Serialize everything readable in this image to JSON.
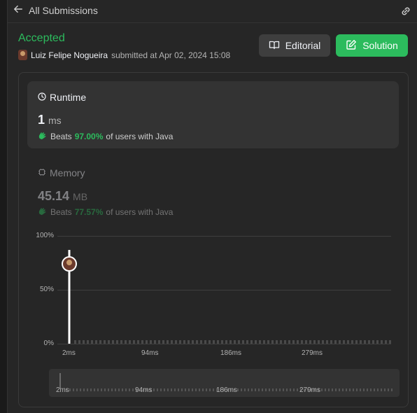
{
  "topbar": {
    "back_label": "All Submissions"
  },
  "submission": {
    "status": "Accepted",
    "author": "Luiz Felipe Nogueira",
    "submitted_text": "submitted at Apr 02, 2024 15:08"
  },
  "buttons": {
    "editorial": "Editorial",
    "solution": "Solution"
  },
  "runtime": {
    "title": "Runtime",
    "value": "1",
    "unit": "ms",
    "beats_prefix": "Beats",
    "beats_pct": "97.00%",
    "beats_suffix": "of users with Java"
  },
  "memory": {
    "title": "Memory",
    "value": "45.14",
    "unit": "MB",
    "beats_prefix": "Beats",
    "beats_pct": "77.57%",
    "beats_suffix": "of users with Java"
  },
  "chart_data": {
    "type": "bar",
    "y_ticks": [
      "100%",
      "50%",
      "0%"
    ],
    "x_ticks": [
      "2ms",
      "94ms",
      "186ms",
      "279ms"
    ],
    "ylim": [
      0,
      100
    ],
    "marker": {
      "x": "2ms",
      "y": 74
    },
    "grid": true
  },
  "scrubber": {
    "labels": [
      "2ms",
      "94ms",
      "186ms",
      "279ms"
    ]
  },
  "colors": {
    "accent": "#2cbb5d",
    "background": "#262626"
  }
}
